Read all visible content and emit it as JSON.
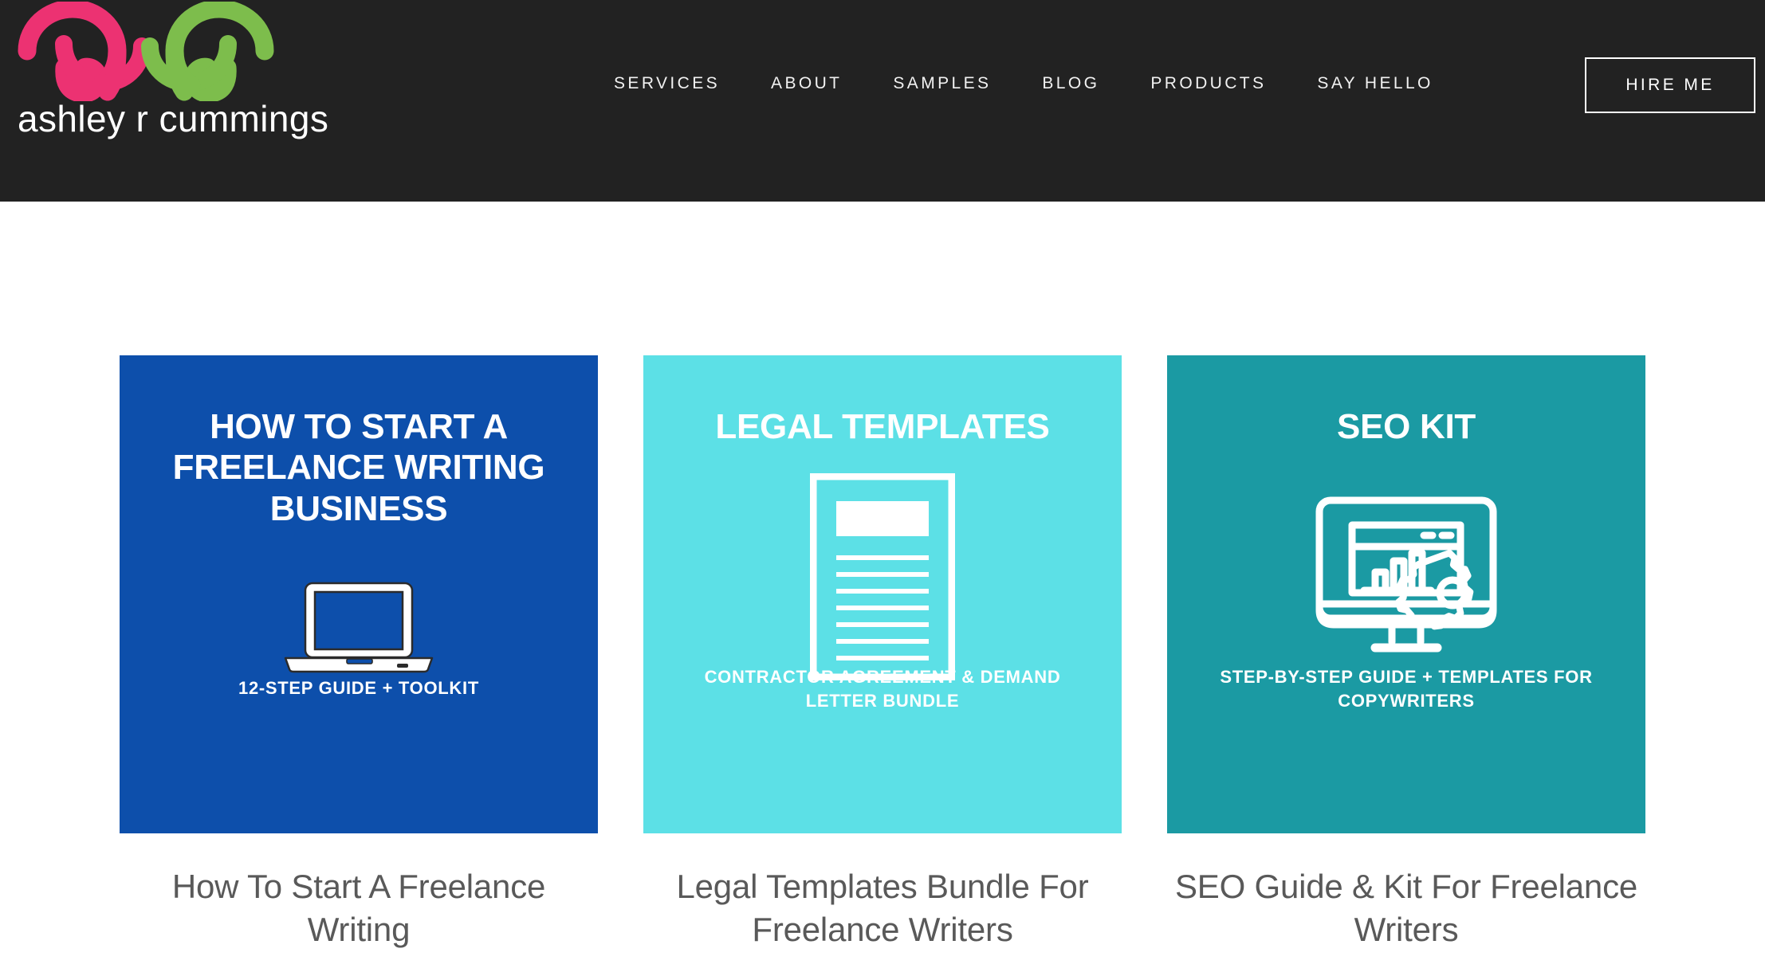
{
  "header": {
    "background_color": "#222222",
    "logo": {
      "name": "ashley r cummings",
      "wordmark": "ashley r cummings",
      "swirl_left_color": "#ec3272",
      "swirl_right_color": "#7dbd4c",
      "icon": "double-spiral-logo"
    },
    "nav": [
      {
        "label": "SERVICES",
        "name": "services"
      },
      {
        "label": "ABOUT",
        "name": "about"
      },
      {
        "label": "SAMPLES",
        "name": "samples"
      },
      {
        "label": "BLOG",
        "name": "blog"
      },
      {
        "label": "PRODUCTS",
        "name": "products"
      },
      {
        "label": "SAY HELLO",
        "name": "say-hello"
      }
    ],
    "cta": {
      "label": "HIRE ME",
      "name": "hire-me"
    }
  },
  "products": [
    {
      "id": "freelance-writing-business",
      "thumb_title": "HOW TO START A FREELANCE WRITING BUSINESS",
      "thumb_subtitle": "12-STEP GUIDE + TOOLKIT",
      "thumb_color": "#0d4fab",
      "icon": "laptop-icon",
      "name": "How To Start A Freelance Writing"
    },
    {
      "id": "legal-templates-bundle",
      "thumb_title": "LEGAL TEMPLATES",
      "thumb_subtitle": "CONTRACTOR AGREEMENT & DEMAND LETTER BUNDLE",
      "thumb_color": "#5ce0e6",
      "icon": "document-icon",
      "name": "Legal Templates Bundle For Freelance Writers"
    },
    {
      "id": "seo-kit",
      "thumb_title": "SEO KIT",
      "thumb_subtitle": "STEP-BY-STEP GUIDE + TEMPLATES FOR COPYWRITERS",
      "thumb_color": "#1b9aa3",
      "icon": "monitor-analytics-icon",
      "name": "SEO Guide & Kit For Freelance Writers"
    }
  ]
}
